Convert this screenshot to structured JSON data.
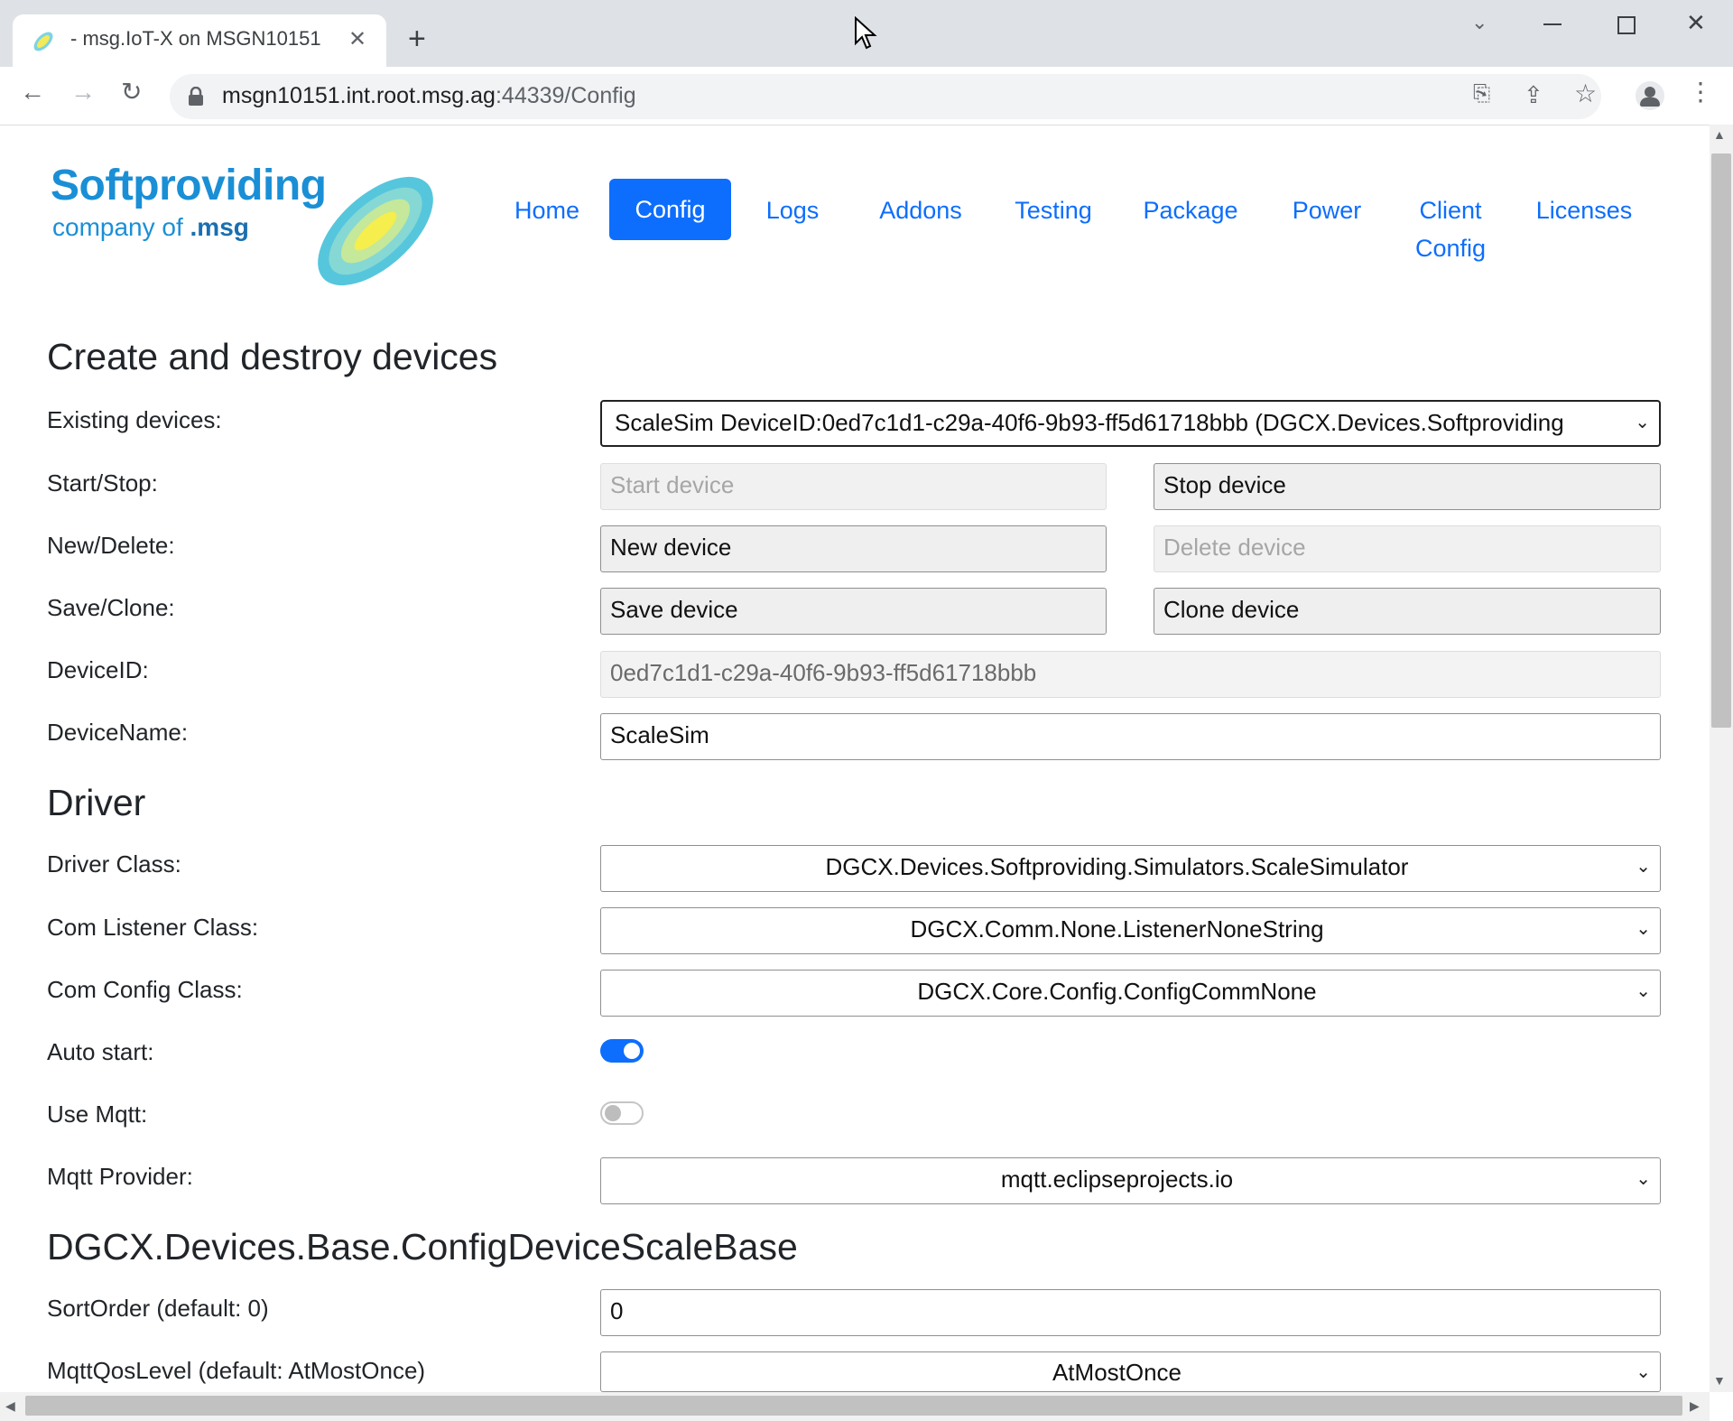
{
  "browser": {
    "tab_title": "- msg.IoT-X on MSGN10151",
    "url_host": "msgn10151.int.root.msg.ag",
    "url_rest": ":44339/Config",
    "icons": [
      "site-favicon",
      "close-icon",
      "plus-icon",
      "chevron-down-icon",
      "minimize-icon",
      "maximize-icon",
      "close-window-icon",
      "back-icon",
      "forward-icon",
      "reload-icon",
      "lock-icon",
      "translate-icon",
      "share-icon",
      "star-icon",
      "profile-icon",
      "menu-icon"
    ]
  },
  "logo": {
    "brand": "Softproviding",
    "tagline": "company of",
    "msg": ".msg"
  },
  "nav": {
    "home": "Home",
    "config": "Config",
    "logs": "Logs",
    "addons": "Addons",
    "testing": "Testing",
    "package": "Package",
    "power": "Power",
    "client_1": "Client",
    "client_2": "Config",
    "licenses": "Licenses"
  },
  "section1": {
    "title": "Create and destroy devices",
    "existing_label": "Existing devices:",
    "existing_value": "ScaleSim DeviceID:0ed7c1d1-c29a-40f6-9b93-ff5d61718bbb (DGCX.Devices.Softproviding",
    "startstop_label": "Start/Stop:",
    "start_btn": "Start device",
    "stop_btn": "Stop device",
    "newdelete_label": "New/Delete:",
    "new_btn": "New device",
    "delete_btn": "Delete device",
    "saveclone_label": "Save/Clone:",
    "save_btn": "Save device",
    "clone_btn": "Clone device",
    "deviceid_label": "DeviceID:",
    "deviceid_value": "0ed7c1d1-c29a-40f6-9b93-ff5d61718bbb",
    "devicename_label": "DeviceName:",
    "devicename_value": "ScaleSim"
  },
  "driver": {
    "title": "Driver",
    "driver_class_label": "Driver Class:",
    "driver_class_value": "DGCX.Devices.Softproviding.Simulators.ScaleSimulator",
    "listener_label": "Com Listener Class:",
    "listener_value": "DGCX.Comm.None.ListenerNoneString",
    "config_label": "Com Config Class:",
    "config_value": "DGCX.Core.Config.ConfigCommNone",
    "autostart_label": "Auto start:",
    "autostart_on": true,
    "usemqtt_label": "Use Mqtt:",
    "usemqtt_on": false,
    "mqtt_provider_label": "Mqtt Provider:",
    "mqtt_provider_value": "mqtt.eclipseprojects.io"
  },
  "scalebase": {
    "title": "DGCX.Devices.Base.ConfigDeviceScaleBase",
    "sortorder_label": "SortOrder (default: 0)",
    "sortorder_value": "0",
    "qos_label": "MqttQosLevel (default: AtMostOnce)",
    "qos_value": "AtMostOnce"
  },
  "colors": {
    "accent": "#0d6efd",
    "chrome": "#dee1e6"
  }
}
